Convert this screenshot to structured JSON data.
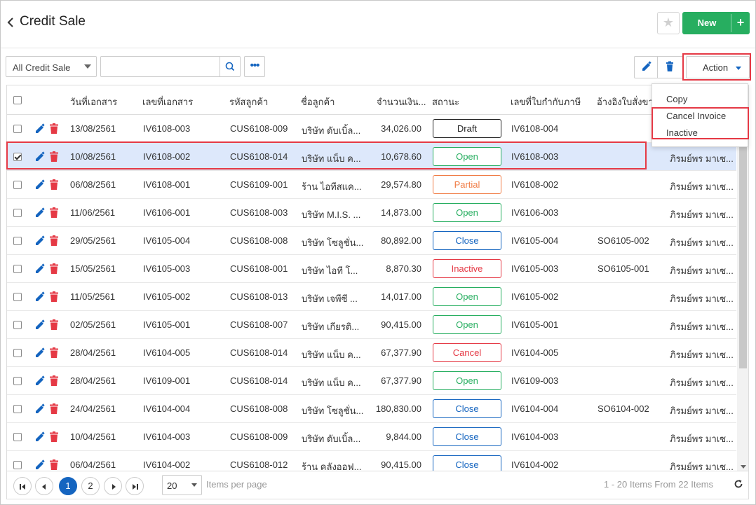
{
  "header": {
    "title": "Credit Sale",
    "back_icon": "chevron-left-icon",
    "star_icon": "star-icon",
    "new_label": "New",
    "new_plus": "+"
  },
  "toolbar": {
    "filter_value": "All Credit Sale",
    "search_value": "",
    "search_placeholder": "",
    "more_label": "•••",
    "action_label": "Action"
  },
  "action_menu": [
    "Copy",
    "Cancel Invoice",
    "Inactive"
  ],
  "columns": [
    "วันที่เอกสาร",
    "เลขที่เอกสาร",
    "รหัสลูกค้า",
    "ชื่อลูกค้า",
    "จำนวนเงิน...",
    "สถานะ",
    "เลขที่ใบกำกับภาษี",
    "อ้างอิงใบสั่งขาย"
  ],
  "rows": [
    {
      "checked": false,
      "date": "13/08/2561",
      "doc_no": "IV6108-003",
      "cust_code": "CUS6108-009",
      "cust_name": "บริษัท ดับเบิ้ล...",
      "amount": "34,026.00",
      "status": "Draft",
      "tax_no": "IV6108-004",
      "so_ref": "",
      "owner": ""
    },
    {
      "checked": true,
      "date": "10/08/2561",
      "doc_no": "IV6108-002",
      "cust_code": "CUS6108-014",
      "cust_name": "บริษัท แน็บ ค...",
      "amount": "10,678.60",
      "status": "Open",
      "tax_no": "IV6108-003",
      "so_ref": "",
      "owner": "ภิรมย์พร มาเซ..."
    },
    {
      "checked": false,
      "date": "06/08/2561",
      "doc_no": "IV6108-001",
      "cust_code": "CUS6109-001",
      "cust_name": "ร้าน ไอทีสแค...",
      "amount": "29,574.80",
      "status": "Partial",
      "tax_no": "IV6108-002",
      "so_ref": "",
      "owner": "ภิรมย์พร มาเซ..."
    },
    {
      "checked": false,
      "date": "11/06/2561",
      "doc_no": "IV6106-001",
      "cust_code": "CUS6108-003",
      "cust_name": "บริษัท M.I.S. ...",
      "amount": "14,873.00",
      "status": "Open",
      "tax_no": "IV6106-003",
      "so_ref": "",
      "owner": "ภิรมย์พร มาเซ..."
    },
    {
      "checked": false,
      "date": "29/05/2561",
      "doc_no": "IV6105-004",
      "cust_code": "CUS6108-008",
      "cust_name": "บริษัท โซลูชั่น...",
      "amount": "80,892.00",
      "status": "Close",
      "tax_no": "IV6105-004",
      "so_ref": "SO6105-002",
      "owner": "ภิรมย์พร มาเซ..."
    },
    {
      "checked": false,
      "date": "15/05/2561",
      "doc_no": "IV6105-003",
      "cust_code": "CUS6108-001",
      "cust_name": "บริษัท ไอที โ...",
      "amount": "8,870.30",
      "status": "Inactive",
      "tax_no": "IV6105-003",
      "so_ref": "SO6105-001",
      "owner": "ภิรมย์พร มาเซ..."
    },
    {
      "checked": false,
      "date": "11/05/2561",
      "doc_no": "IV6105-002",
      "cust_code": "CUS6108-013",
      "cust_name": "บริษัท เจพีซี ...",
      "amount": "14,017.00",
      "status": "Open",
      "tax_no": "IV6105-002",
      "so_ref": "",
      "owner": "ภิรมย์พร มาเซ..."
    },
    {
      "checked": false,
      "date": "02/05/2561",
      "doc_no": "IV6105-001",
      "cust_code": "CUS6108-007",
      "cust_name": "บริษัท เกียรติ...",
      "amount": "90,415.00",
      "status": "Open",
      "tax_no": "IV6105-001",
      "so_ref": "",
      "owner": "ภิรมย์พร มาเซ..."
    },
    {
      "checked": false,
      "date": "28/04/2561",
      "doc_no": "IV6104-005",
      "cust_code": "CUS6108-014",
      "cust_name": "บริษัท แน็บ ค...",
      "amount": "67,377.90",
      "status": "Cancel",
      "tax_no": "IV6104-005",
      "so_ref": "",
      "owner": "ภิรมย์พร มาเซ..."
    },
    {
      "checked": false,
      "date": "28/04/2561",
      "doc_no": "IV6109-001",
      "cust_code": "CUS6108-014",
      "cust_name": "บริษัท แน็บ ค...",
      "amount": "67,377.90",
      "status": "Open",
      "tax_no": "IV6109-003",
      "so_ref": "",
      "owner": "ภิรมย์พร มาเซ..."
    },
    {
      "checked": false,
      "date": "24/04/2561",
      "doc_no": "IV6104-004",
      "cust_code": "CUS6108-008",
      "cust_name": "บริษัท โซลูชั่น...",
      "amount": "180,830.00",
      "status": "Close",
      "tax_no": "IV6104-004",
      "so_ref": "SO6104-002",
      "owner": "ภิรมย์พร มาเซ..."
    },
    {
      "checked": false,
      "date": "10/04/2561",
      "doc_no": "IV6104-003",
      "cust_code": "CUS6108-009",
      "cust_name": "บริษัท ดับเบิ้ล...",
      "amount": "9,844.00",
      "status": "Close",
      "tax_no": "IV6104-003",
      "so_ref": "",
      "owner": "ภิรมย์พร มาเซ..."
    },
    {
      "checked": false,
      "date": "06/04/2561",
      "doc_no": "IV6104-002",
      "cust_code": "CUS6108-012",
      "cust_name": "ร้าน คลังออฟ...",
      "amount": "90,415.00",
      "status": "Close",
      "tax_no": "IV6104-002",
      "so_ref": "",
      "owner": "ภิรมย์พร มาเซ..."
    }
  ],
  "status_colors": {
    "Draft": "#222222",
    "Open": "#27ae60",
    "Partial": "#f07c45",
    "Close": "#1565c0",
    "Inactive": "#e53945",
    "Cancel": "#e53945"
  },
  "pager": {
    "pages": [
      "1",
      "2"
    ],
    "current_page": "1",
    "page_size": "20",
    "items_per_page_label": "Items per page",
    "info": "1 - 20 Items From 22 Items",
    "refresh_icon": "refresh-icon"
  },
  "colors": {
    "accent": "#1565c0",
    "new_button": "#27ae60",
    "delete_icon": "#e53945",
    "highlight": "#e53945",
    "selected_row": "#dde8fb"
  }
}
